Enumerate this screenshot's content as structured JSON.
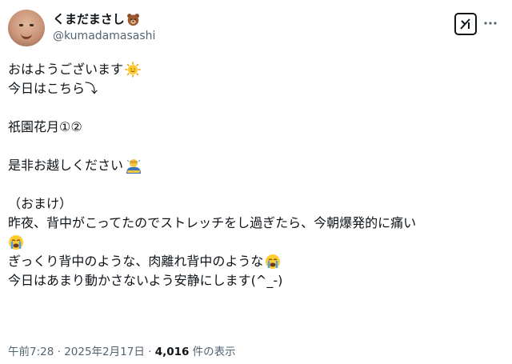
{
  "user": {
    "display_name": "くまだまさし",
    "handle": "@kumadamasashi"
  },
  "post": {
    "lines": [
      "おはようございます",
      "今日はこちら⤵",
      "",
      "祇園花月①②",
      "",
      "是非お越しください",
      "",
      "（おまけ）",
      "昨夜、背中がこってたのでストレッチをし過ぎたら、今朝爆発的に痛い",
      "",
      "ぎっくり背中のような、肉離れ背中のような",
      "今日はあまり動かさないよう安静にします(^_-)"
    ]
  },
  "meta": {
    "timestamp": "午前7:28 · 2025年2月17日 · ",
    "views_count": "4,016",
    "views_label": " 件の表示"
  },
  "icons": {
    "grok": "grok-icon",
    "more": "more-icon",
    "bear": "bear-emoji",
    "sun": "sun-emoji",
    "person": "bowing-person-emoji",
    "cry": "crying-face-emoji"
  }
}
